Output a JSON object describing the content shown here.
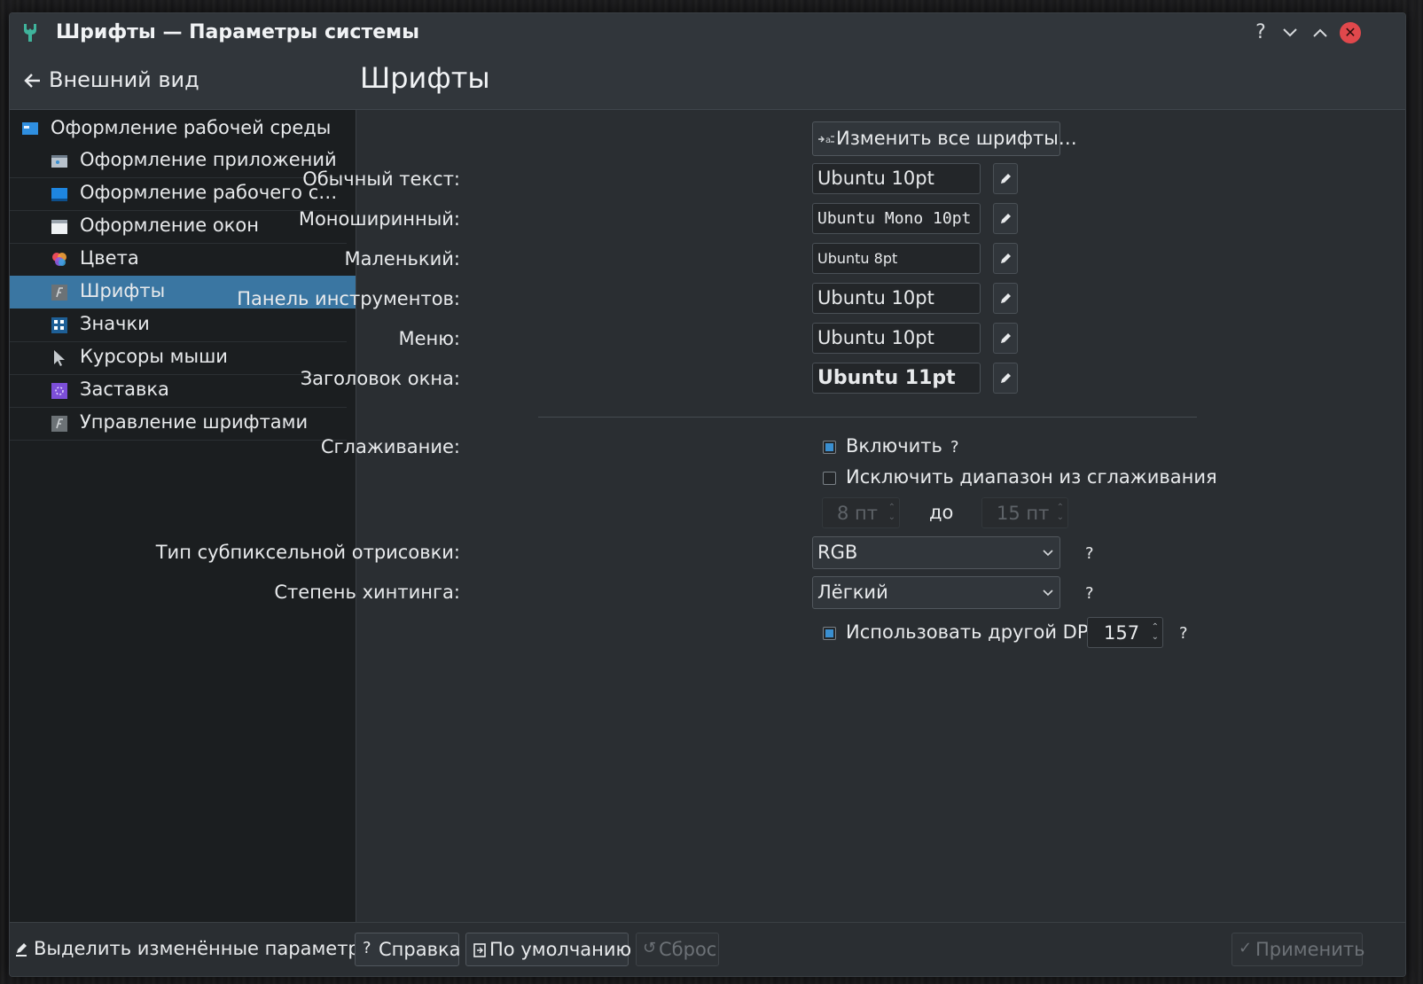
{
  "window": {
    "title": "Шрифты — Параметры системы",
    "help_glyph": "?",
    "minimize_glyph": "⌄",
    "maximize_glyph": "⌃",
    "close_glyph": "✕"
  },
  "header": {
    "back_label": "Внешний вид",
    "page_title": "Шрифты"
  },
  "sidebar": {
    "category": {
      "label": "Оформление рабочей среды",
      "icon": "workspace-theme-icon"
    },
    "items": [
      {
        "label": "Оформление приложений",
        "icon": "app-style-icon"
      },
      {
        "label": "Оформление рабочего с…",
        "icon": "desktop-theme-icon"
      },
      {
        "label": "Оформление окон",
        "icon": "window-decoration-icon"
      },
      {
        "label": "Цвета",
        "icon": "colors-icon"
      },
      {
        "label": "Шрифты",
        "icon": "fonts-icon",
        "selected": true
      },
      {
        "label": "Значки",
        "icon": "icons-icon"
      },
      {
        "label": "Курсоры мыши",
        "icon": "cursor-icon"
      },
      {
        "label": "Заставка",
        "icon": "splash-icon"
      },
      {
        "label": "Управление шрифтами",
        "icon": "font-manager-icon"
      }
    ]
  },
  "fonts": {
    "change_all_label": "Изменить все шрифты…",
    "rows": [
      {
        "label": "Обычный текст:",
        "value": "Ubuntu 10pt"
      },
      {
        "label": "Моноширинный:",
        "value": "Ubuntu Mono 10pt"
      },
      {
        "label": "Маленький:",
        "value": "Ubuntu 8pt"
      },
      {
        "label": "Панель инструментов:",
        "value": "Ubuntu 10pt"
      },
      {
        "label": "Меню:",
        "value": "Ubuntu 10pt"
      },
      {
        "label": "Заголовок окна:",
        "value": "Ubuntu 11pt"
      }
    ]
  },
  "antialiasing": {
    "label": "Сглаживание:",
    "enable_label": "Включить",
    "enabled": true,
    "exclude_label": "Исключить диапазон из сглаживания",
    "exclude_checked": false,
    "range_from": "8 пт",
    "range_to_label": "до",
    "range_to": "15 пт"
  },
  "subpixel": {
    "label": "Тип субпиксельной отрисовки:",
    "value": "RGB"
  },
  "hinting": {
    "label": "Степень хинтинга:",
    "value": "Лёгкий"
  },
  "dpi": {
    "label": "Использовать другой DPI:",
    "checked": true,
    "value": "157"
  },
  "help_mark": "?",
  "footer": {
    "highlight_label": "Выделить изменённые параметры",
    "help_label": "Справка",
    "defaults_label": "По умолчанию",
    "reset_label": "Сброс",
    "apply_label": "Применить"
  },
  "colors": {
    "accent": "#3a76a2",
    "check_accent": "#3a8fd0",
    "close": "#e0484c"
  }
}
